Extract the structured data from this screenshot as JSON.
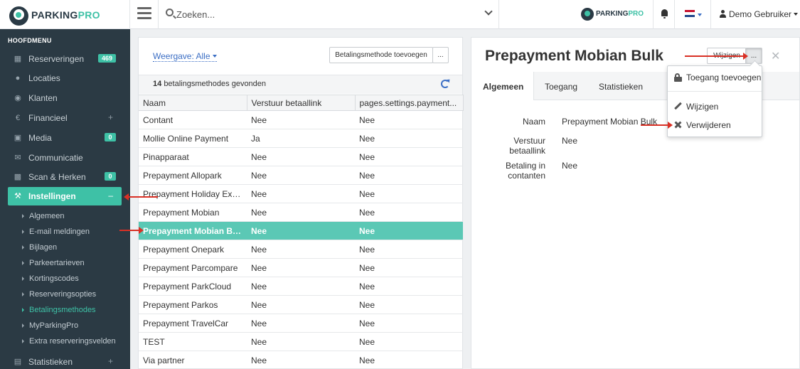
{
  "app": {
    "logo_main": "PARKING",
    "logo_accent": "PRO"
  },
  "topbar": {
    "search_placeholder": "Zoeken...",
    "user_name": "Demo Gebruiker"
  },
  "sidebar": {
    "title": "HOOFDMENU",
    "items": [
      {
        "label": "Reserveringen",
        "icon": "calendar-icon",
        "badge": "469"
      },
      {
        "label": "Locaties",
        "icon": "map-marker-icon"
      },
      {
        "label": "Klanten",
        "icon": "users-icon"
      },
      {
        "label": "Financieel",
        "icon": "euro-icon",
        "plus": "+"
      },
      {
        "label": "Media",
        "icon": "image-icon",
        "badge": "0"
      },
      {
        "label": "Communicatie",
        "icon": "envelope-icon"
      },
      {
        "label": "Scan & Herken",
        "icon": "camera-icon",
        "badge": "0"
      },
      {
        "label": "Instellingen",
        "icon": "wrench-icon",
        "minus": "–"
      },
      {
        "label": "Statistieken",
        "icon": "chart-icon",
        "plus": "+"
      }
    ],
    "sub_items": [
      "Algemeen",
      "E-mail meldingen",
      "Bijlagen",
      "Parkeertarieven",
      "Kortingscodes",
      "Reserveringsopties",
      "Betalingsmethodes",
      "MyParkingPro",
      "Extra reserveringsvelden"
    ]
  },
  "list": {
    "view_label": "Weergave: Alle",
    "add_button": "Betalingsmethode toevoegen",
    "more_button": "...",
    "count": "14",
    "count_text": "betalingsmethodes gevonden",
    "columns": [
      "Naam",
      "Verstuur betaallink",
      "pages.settings.payment..."
    ],
    "rows": [
      [
        "Contant",
        "Nee",
        "Nee"
      ],
      [
        "Mollie Online Payment",
        "Ja",
        "Nee"
      ],
      [
        "Pinapparaat",
        "Nee",
        "Nee"
      ],
      [
        "Prepayment Allopark",
        "Nee",
        "Nee"
      ],
      [
        "Prepayment Holiday Extr...",
        "Nee",
        "Nee"
      ],
      [
        "Prepayment Mobian",
        "Nee",
        "Nee"
      ],
      [
        "Prepayment Mobian Bulk",
        "Nee",
        "Nee"
      ],
      [
        "Prepayment Onepark",
        "Nee",
        "Nee"
      ],
      [
        "Prepayment Parcompare",
        "Nee",
        "Nee"
      ],
      [
        "Prepayment ParkCloud",
        "Nee",
        "Nee"
      ],
      [
        "Prepayment Parkos",
        "Nee",
        "Nee"
      ],
      [
        "Prepayment TravelCar",
        "Nee",
        "Nee"
      ],
      [
        "TEST",
        "Nee",
        "Nee"
      ],
      [
        "Via partner",
        "Nee",
        "Nee"
      ]
    ],
    "selected_row": "Prepayment Mobian Bulk"
  },
  "detail": {
    "title": "Prepayment Mobian Bulk",
    "edit_button": "Wijzigen",
    "more_button": "...",
    "tabs": [
      "Algemeen",
      "Toegang",
      "Statistieken"
    ],
    "fields": [
      {
        "label_lines": [
          "Naam"
        ],
        "value": "Prepayment Mobian Bulk"
      },
      {
        "label_lines": [
          "Verstuur",
          "betaallink"
        ],
        "value": "Nee"
      },
      {
        "label_lines": [
          "Betaling in",
          "contanten"
        ],
        "value": "Nee"
      }
    ]
  },
  "dropdown": {
    "items": [
      {
        "label": "Toegang toevoegen",
        "icon": "lock-icon"
      },
      {
        "label": "Wijzigen",
        "icon": "pencil-icon"
      },
      {
        "label": "Verwijderen",
        "icon": "times-icon"
      }
    ]
  },
  "colors": {
    "accent": "#3ec1a6",
    "sidebar_bg": "#2b3a44",
    "selected_row": "#5bc8b5",
    "link": "#3b6ec4",
    "annotation": "#d93025"
  }
}
